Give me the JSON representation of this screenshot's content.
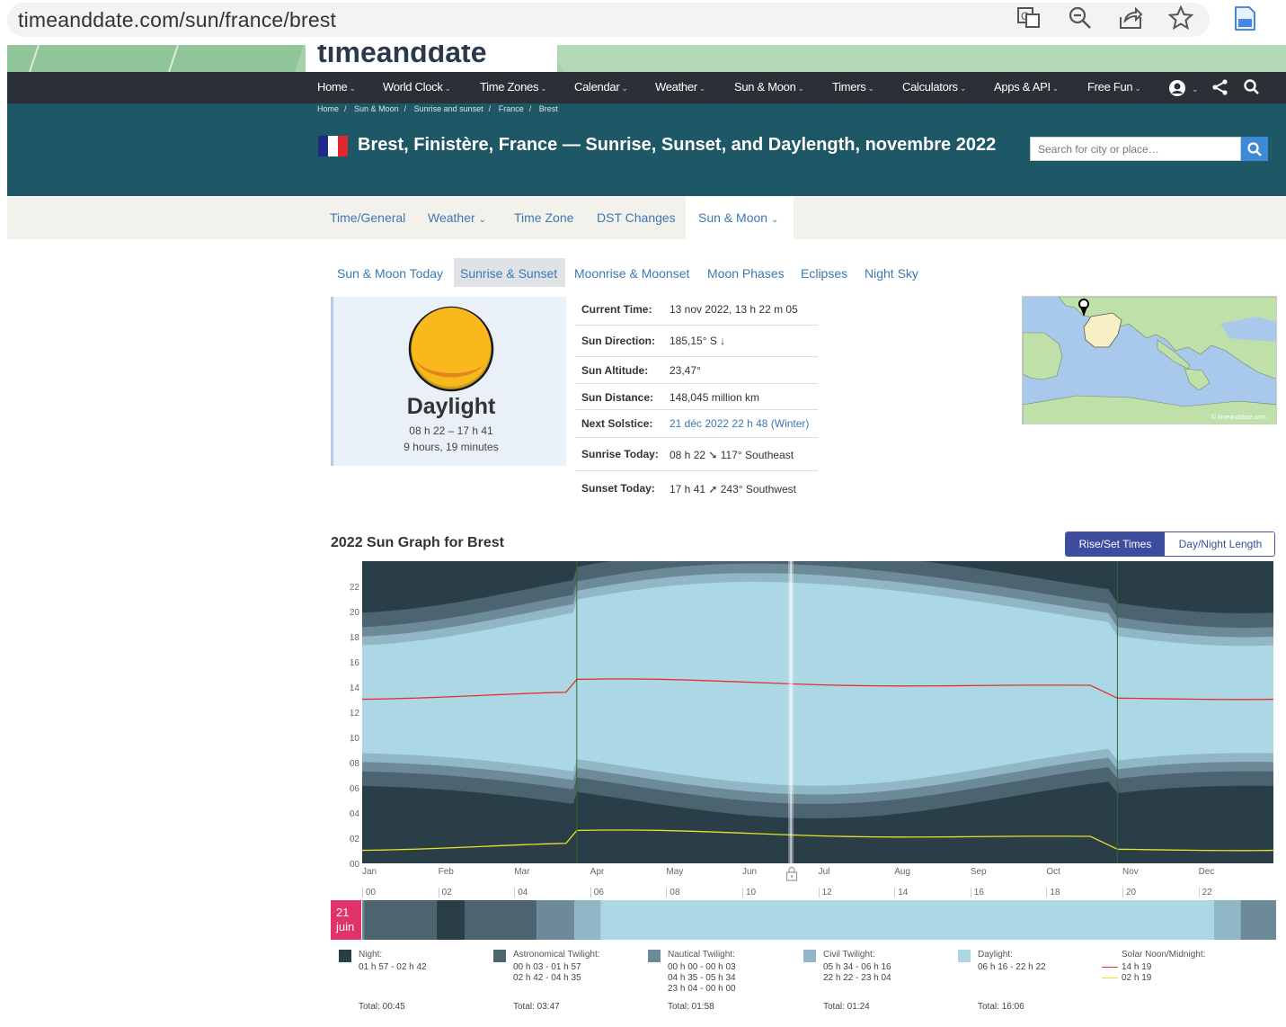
{
  "browser": {
    "url": "timeanddate.com/sun/france/brest",
    "icons": [
      "translate-icon",
      "zoom-icon",
      "share-icon",
      "star-icon",
      "extension-icon"
    ]
  },
  "logo": {
    "text": "timeanddate"
  },
  "nav": {
    "items": [
      "Home",
      "World Clock",
      "Time Zones",
      "Calendar",
      "Weather",
      "Sun & Moon",
      "Timers",
      "Calculators",
      "Apps & API",
      "Free Fun"
    ]
  },
  "breadcrumb": [
    "Home",
    "Sun & Moon",
    "Sunrise and sunset",
    "France",
    "Brest"
  ],
  "header": {
    "title": "Brest, Finistère, France — Sunrise, Sunset, and Daylength, novembre 2022",
    "search_placeholder": "Search for city or place…"
  },
  "subnav": {
    "items": [
      "Time/General",
      "Weather",
      "Time Zone",
      "DST Changes",
      "Sun & Moon"
    ],
    "active": "Sun & Moon"
  },
  "tabs": {
    "items": [
      "Sun & Moon Today",
      "Sunrise & Sunset",
      "Moonrise & Moonset",
      "Moon Phases",
      "Eclipses",
      "Night Sky"
    ],
    "active": "Sunrise & Sunset"
  },
  "sun_card": {
    "label": "Daylight",
    "range": "08 h 22 – 17 h 41",
    "length": "9 hours, 19 minutes"
  },
  "info": {
    "current_time": {
      "label": "Current Time:",
      "value": "13 nov 2022, 13 h 22 m 05"
    },
    "sun_direction": {
      "label": "Sun Direction:",
      "value": "185,15° S ↓"
    },
    "sun_altitude": {
      "label": "Sun Altitude:",
      "value": "23,47°"
    },
    "sun_distance": {
      "label": "Sun Distance:",
      "value": "148,045 million km"
    },
    "next_solstice": {
      "label": "Next Solstice:",
      "value": "21 déc 2022 22 h 48 (Winter)"
    },
    "sunrise_today": {
      "label": "Sunrise Today:",
      "value": "08 h 22 ➘ 117° Southeast"
    },
    "sunset_today": {
      "label": "Sunset Today:",
      "value": "17 h 41 ➚ 243° Southwest"
    }
  },
  "map": {
    "credit": "© timeanddate.com"
  },
  "graph": {
    "title": "2022 Sun Graph for Brest",
    "toggle": [
      "Rise/Set Times",
      "Day/Night Length"
    ],
    "toggle_active": "Rise/Set Times",
    "y_ticks": [
      "22",
      "20",
      "18",
      "16",
      "14",
      "12",
      "10",
      "08",
      "06",
      "04",
      "02",
      "00"
    ],
    "months": [
      "Jan",
      "Feb",
      "Mar",
      "Apr",
      "May",
      "Jun",
      "Jul",
      "Aug",
      "Sep",
      "Oct",
      "Nov",
      "Dec"
    ],
    "hours": [
      "00",
      "02",
      "04",
      "06",
      "08",
      "10",
      "12",
      "14",
      "16",
      "18",
      "20",
      "22"
    ],
    "colors": {
      "night": "#2a3e48",
      "astro": "#4b6470",
      "nautical": "#6c8a98",
      "civil": "#91b6c6",
      "day": "#acd8e6",
      "noon": "#e53030",
      "midnight": "#e6e028"
    }
  },
  "chart_data": {
    "type": "area",
    "title": "2022 Sun Graph for Brest",
    "x": [
      "Jan",
      "Feb",
      "Mar",
      "Apr",
      "May",
      "Jun",
      "Jul",
      "Aug",
      "Sep",
      "Oct",
      "Nov",
      "Dec"
    ],
    "ylim": [
      0,
      24
    ],
    "dst_boundaries": [
      "Mar 27",
      "Oct 30"
    ],
    "series": [
      {
        "name": "Night",
        "values": [
          0,
          0,
          0,
          0,
          0,
          0,
          0,
          0,
          0,
          0,
          0,
          0
        ]
      },
      {
        "name": "Daylight",
        "values": [
          8.9,
          10.1,
          11.7,
          13.5,
          15.1,
          16.1,
          15.8,
          14.5,
          12.8,
          11.1,
          9.5,
          8.6
        ]
      },
      {
        "name": "Solar Noon/Midnight",
        "values": [
          13.2,
          13.4,
          13.3,
          14.2,
          14.1,
          14.2,
          14.3,
          14.2,
          14.0,
          14.0,
          12.9,
          13.1
        ]
      }
    ]
  },
  "day_strip": {
    "date_day": "21",
    "date_month": "juin"
  },
  "legend": [
    {
      "title": "Night:",
      "lines": [
        "01 h 57 - 02 h 42"
      ],
      "total": "Total: 00:45",
      "color": "#2a3e48"
    },
    {
      "title": "Astronomical Twilight:",
      "lines": [
        "00 h 03 - 01 h 57",
        "02 h 42 - 04 h 35"
      ],
      "total": "Total: 03:47",
      "color": "#4b6470"
    },
    {
      "title": "Nautical Twilight:",
      "lines": [
        "00 h 00 - 00 h 03",
        "04 h 35 - 05 h 34",
        "23 h 04 - 00 h 00"
      ],
      "total": "Total: 01:58",
      "color": "#6c8a98"
    },
    {
      "title": "Civil Twilight:",
      "lines": [
        "05 h 34 - 06 h 16",
        "22 h 22 - 23 h 04"
      ],
      "total": "Total: 01:24",
      "color": "#91b6c6"
    },
    {
      "title": "Daylight:",
      "lines": [
        "06 h 16 - 22 h 22"
      ],
      "total": "Total: 16:06",
      "color": "#acd8e6"
    },
    {
      "title": "Solar Noon/Midnight:",
      "lines": [
        "14 h 19",
        "02 h 19"
      ],
      "total": "",
      "color": ""
    }
  ]
}
